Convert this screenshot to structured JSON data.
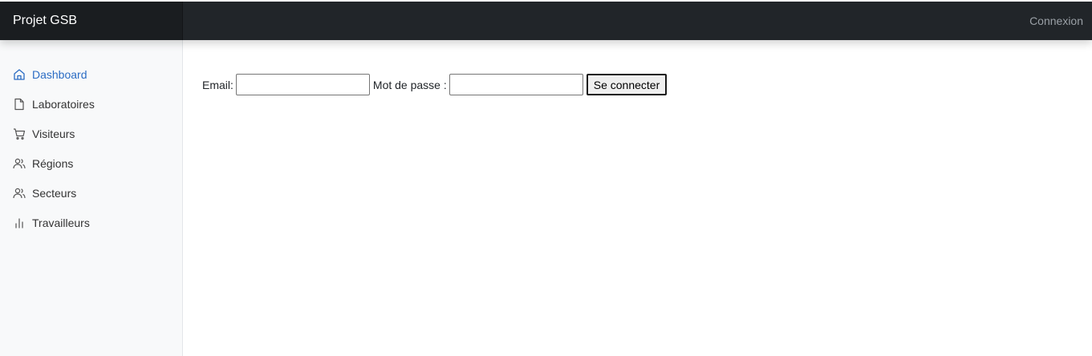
{
  "navbar": {
    "brand": "Projet GSB",
    "login_link": "Connexion"
  },
  "sidebar": {
    "items": [
      {
        "label": "Dashboard",
        "icon": "home-icon",
        "active": true
      },
      {
        "label": "Laboratoires",
        "icon": "file-icon",
        "active": false
      },
      {
        "label": "Visiteurs",
        "icon": "cart-icon",
        "active": false
      },
      {
        "label": "Régions",
        "icon": "users-icon",
        "active": false
      },
      {
        "label": "Secteurs",
        "icon": "users-icon",
        "active": false
      },
      {
        "label": "Travailleurs",
        "icon": "bar-chart-icon",
        "active": false
      }
    ]
  },
  "form": {
    "email_label": "Email:",
    "email_value": "",
    "password_label": "Mot de passe :",
    "password_value": "",
    "submit_label": "Se connecter"
  },
  "colors": {
    "navbar_bg": "#212529",
    "brand_bg": "#1a1d20",
    "sidebar_bg": "#f8f9fa",
    "active_link": "#2b6cc4"
  }
}
